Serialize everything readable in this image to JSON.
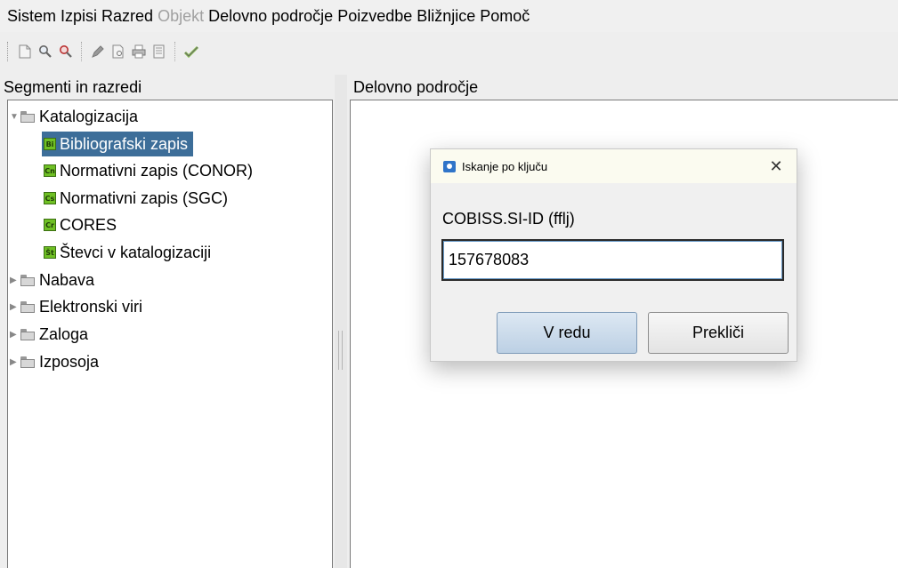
{
  "menu": {
    "items": [
      {
        "label": "Sistem",
        "disabled": false
      },
      {
        "label": "Izpisi",
        "disabled": false
      },
      {
        "label": "Razred",
        "disabled": false
      },
      {
        "label": "Objekt",
        "disabled": true
      },
      {
        "label": "Delovno področje",
        "disabled": false
      },
      {
        "label": "Poizvedbe",
        "disabled": false
      },
      {
        "label": "Bližnjice",
        "disabled": false
      },
      {
        "label": "Pomoč",
        "disabled": false
      }
    ]
  },
  "toolbar": {
    "icons": [
      "new-document-icon",
      "search-icon",
      "search-key-icon",
      "edit-pencil-icon",
      "preview-document-icon",
      "print-icon",
      "print-list-icon",
      "verify-check-icon"
    ]
  },
  "left_panel": {
    "title": "Segmenti in razredi",
    "tree": {
      "root": "Katalogizacija",
      "children": [
        {
          "badge": "Bi",
          "label": "Bibliografski zapis",
          "selected": true
        },
        {
          "badge": "Cn",
          "label": "Normativni zapis (CONOR)"
        },
        {
          "badge": "Cs",
          "label": "Normativni zapis (SGC)"
        },
        {
          "badge": "Cr",
          "label": "CORES"
        },
        {
          "badge": "Št",
          "label": "Števci v katalogizaciji"
        }
      ],
      "collapsed": [
        "Nabava",
        "Elektronski viri",
        "Zaloga",
        "Izposoja"
      ]
    }
  },
  "right_panel": {
    "title": "Delovno področje"
  },
  "dialog": {
    "title": "Iskanje po ključu",
    "field_label": "COBISS.SI-ID (fflj)",
    "field_value": "157678083",
    "ok_label": "V redu",
    "cancel_label": "Prekliči"
  },
  "colors": {
    "selection": "#3d6e99",
    "badge_green": "#6fc024",
    "ok_button": "#c8d8e8"
  }
}
